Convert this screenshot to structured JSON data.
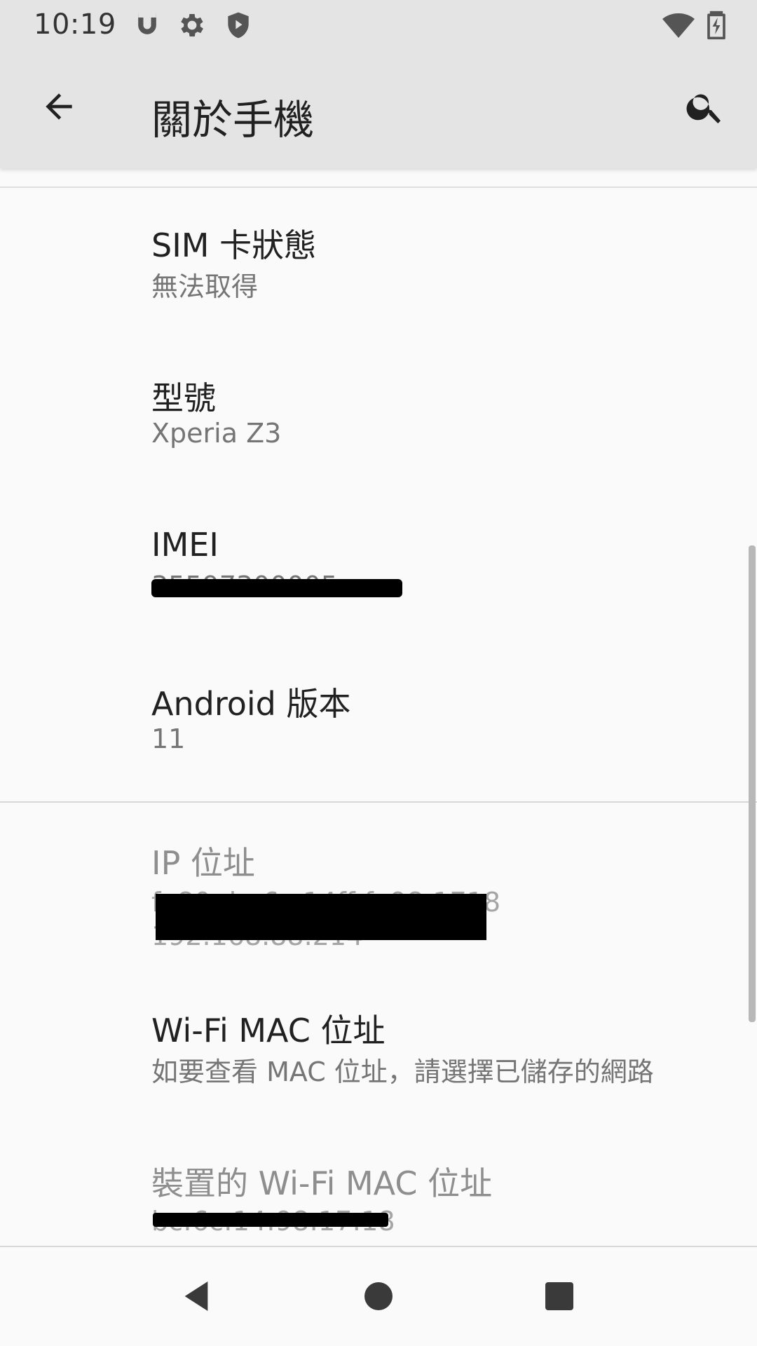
{
  "status_bar": {
    "time": "10:19",
    "left_icons": [
      "magnet-icon",
      "gear-icon",
      "shield-play-icon"
    ],
    "right_icons": [
      "wifi-icon",
      "battery-charging-icon"
    ]
  },
  "app_bar": {
    "title": "關於手機",
    "back_icon": "arrow-back-icon",
    "search_icon": "search-icon"
  },
  "items": [
    {
      "title": "SIM 卡狀態",
      "summary": "無法取得"
    },
    {
      "title": "型號",
      "summary": "Xperia Z3"
    },
    {
      "title": "IMEI",
      "summary": "35597300005"
    },
    {
      "title": "Android 版本",
      "summary": "11"
    },
    {
      "title": "IP 位址",
      "summary_line1": "fe80::be6c:14ff:fe98:1718",
      "summary_line2": "192.168.88.214"
    },
    {
      "title": "Wi-Fi MAC 位址",
      "summary": "如要查看 MAC 位址，請選擇已儲存的網路"
    },
    {
      "title": "裝置的 Wi-Fi MAC 位址",
      "summary": "bc:6c:14:98:17:18"
    }
  ],
  "nav_bar": {
    "icons": [
      "nav-back-icon",
      "nav-home-icon",
      "nav-recents-icon"
    ]
  },
  "colors": {
    "header_bg": "#e4e4e4",
    "content_bg": "#fafafa",
    "title_text": "#212121",
    "summary_text": "#757575"
  }
}
